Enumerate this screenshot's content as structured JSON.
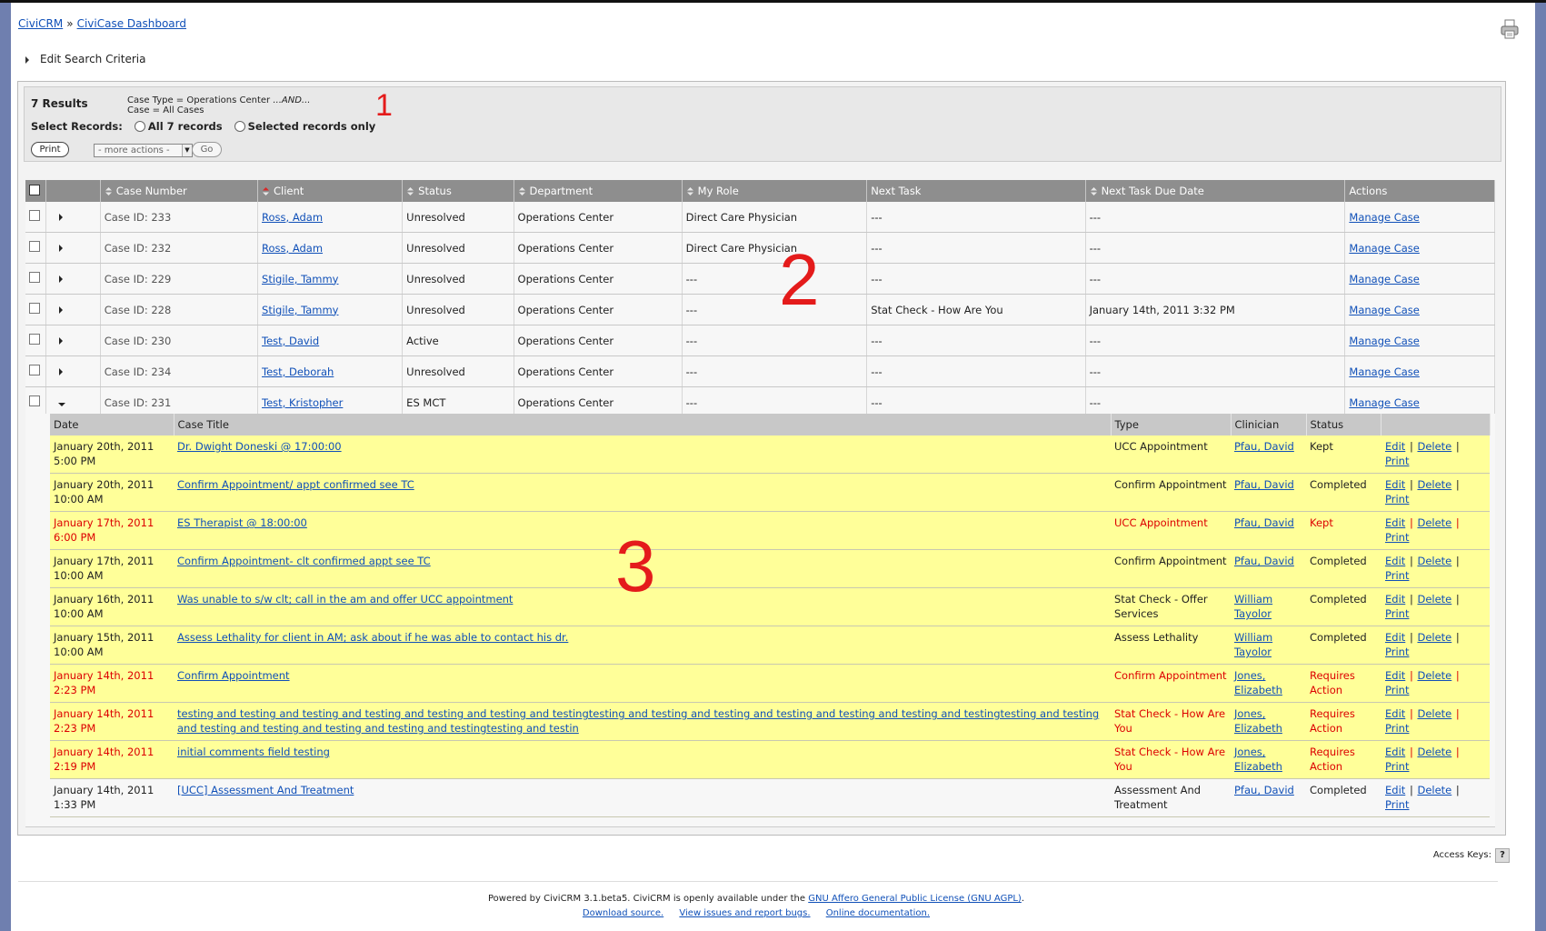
{
  "breadcrumb": {
    "home": "CiviCRM",
    "sep": "»",
    "current": "CiviCase Dashboard"
  },
  "search": {
    "edit_label": "Edit Search Criteria"
  },
  "summary": {
    "count": "7 Results",
    "criteria_line1_a": "Case Type = Operations Center ",
    "criteria_line1_b": "...AND...",
    "criteria_line2": "Case = All Cases",
    "select_label": "Select Records:",
    "opt_all": "All 7 records",
    "opt_selected": "Selected records only",
    "print": "Print",
    "more_actions": "- more actions -",
    "go": "Go"
  },
  "overlays": {
    "one": "1",
    "two": "2",
    "three": "3"
  },
  "cases": {
    "headers": {
      "case_number": "Case Number",
      "client": "Client",
      "status": "Status",
      "department": "Department",
      "my_role": "My Role",
      "next_task": "Next Task",
      "next_task_due": "Next Task Due Date",
      "actions": "Actions"
    },
    "rows": [
      {
        "id": "Case ID: 233",
        "client": "Ross, Adam",
        "status": "Unresolved",
        "dept": "Operations Center",
        "role": "Direct Care Physician",
        "task": "---",
        "due": "---",
        "action": "Manage Case"
      },
      {
        "id": "Case ID: 232",
        "client": "Ross, Adam",
        "status": "Unresolved",
        "dept": "Operations Center",
        "role": "Direct Care Physician",
        "task": "---",
        "due": "---",
        "action": "Manage Case"
      },
      {
        "id": "Case ID: 229",
        "client": "Stigile, Tammy",
        "status": "Unresolved",
        "dept": "Operations Center",
        "role": "---",
        "task": "---",
        "due": "---",
        "action": "Manage Case"
      },
      {
        "id": "Case ID: 228",
        "client": "Stigile, Tammy",
        "status": "Unresolved",
        "dept": "Operations Center",
        "role": "---",
        "task": "Stat Check - How Are You",
        "due": "January 14th, 2011 3:32 PM",
        "action": "Manage Case"
      },
      {
        "id": "Case ID: 230",
        "client": "Test, David",
        "status": "Active",
        "dept": "Operations Center",
        "role": "---",
        "task": "---",
        "due": "---",
        "action": "Manage Case"
      },
      {
        "id": "Case ID: 234",
        "client": "Test, Deborah",
        "status": "Unresolved",
        "dept": "Operations Center",
        "role": "---",
        "task": "---",
        "due": "---",
        "action": "Manage Case"
      },
      {
        "id": "Case ID: 231",
        "client": "Test, Kristopher",
        "status": "ES MCT",
        "dept": "Operations Center",
        "role": "---",
        "task": "---",
        "due": "---",
        "action": "Manage Case"
      }
    ]
  },
  "activities": {
    "headers": {
      "date": "Date",
      "title": "Case Title",
      "type": "Type",
      "clinician": "Clinician",
      "status": "Status"
    },
    "action_labels": {
      "edit": "Edit",
      "delete": "Delete",
      "print": "Print",
      "sep": "|"
    },
    "rows": [
      {
        "date1": "January 20th, 2011",
        "date2": "5:00 PM",
        "title": "Dr. Dwight Doneski @ 17:00:00",
        "type": "UCC Appointment",
        "clin": "Pfau, David",
        "status": "Kept"
      },
      {
        "date1": "January 20th, 2011",
        "date2": "10:00 AM",
        "title": "Confirm Appointment/ appt confirmed see TC",
        "type": "Confirm Appointment",
        "clin": "Pfau, David",
        "status": "Completed"
      },
      {
        "date1": "January 17th, 2011",
        "date2": "6:00 PM",
        "title": "ES Therapist @ 18:00:00",
        "type": "UCC Appointment",
        "clin": "Pfau, David",
        "status": "Kept"
      },
      {
        "date1": "January 17th, 2011",
        "date2": "10:00 AM",
        "title": "Confirm Appointment- clt confirmed appt see TC",
        "type": "Confirm Appointment",
        "clin": "Pfau, David",
        "status": "Completed"
      },
      {
        "date1": "January 16th, 2011",
        "date2": "10:00 AM",
        "title": "Was unable to s/w clt; call in the am and offer UCC appointment",
        "type": "Stat Check - Offer Services",
        "clin": "William Tayolor",
        "status": "Completed"
      },
      {
        "date1": "January 15th, 2011",
        "date2": "10:00 AM",
        "title": "Assess Lethality for client in AM; ask about if he was able to contact his dr.",
        "type": "Assess Lethality",
        "clin": "William Tayolor",
        "status": "Completed"
      },
      {
        "date1": "January 14th, 2011",
        "date2": "2:23 PM",
        "title": "Confirm Appointment",
        "type": "Confirm Appointment",
        "clin": "Jones, Elizabeth",
        "status": "Requires Action"
      },
      {
        "date1": "January 14th, 2011",
        "date2": "2:23 PM",
        "title": "testing and testing and testing and testing and testing and testing and testingtesting and testing and testing and testing and testing and testing and testingtesting and testing and testing and testing and testing and testing and testingtesting and testin",
        "type": "Stat Check - How Are You",
        "clin": "Jones, Elizabeth",
        "status": "Requires Action"
      },
      {
        "date1": "January 14th, 2011",
        "date2": "2:19 PM",
        "title": "initial comments field testing",
        "type": "Stat Check - How Are You",
        "clin": "Jones, Elizabeth",
        "status": "Requires Action"
      },
      {
        "date1": "January 14th, 2011",
        "date2": "1:33 PM",
        "title": "[UCC] Assessment And Treatment",
        "type": "Assessment And Treatment",
        "clin": "Pfau, David",
        "status": "Completed"
      }
    ]
  },
  "access_keys": {
    "label": "Access Keys:",
    "key": "?"
  },
  "footer": {
    "line1_a": "Powered by CiviCRM 3.1.beta5. CiviCRM is openly available under the ",
    "license_link": "GNU Affero General Public License (GNU AGPL)",
    "line1_b": ".",
    "download": "Download source.",
    "issues": "View issues and report bugs.",
    "docs": "Online documentation."
  },
  "colors": {
    "header_bg": "#8e8e8e",
    "activity_bg": "#ffff99",
    "overdue_text": "#dd0000",
    "link": "#1050b8",
    "annotation": "#e41b1b"
  }
}
